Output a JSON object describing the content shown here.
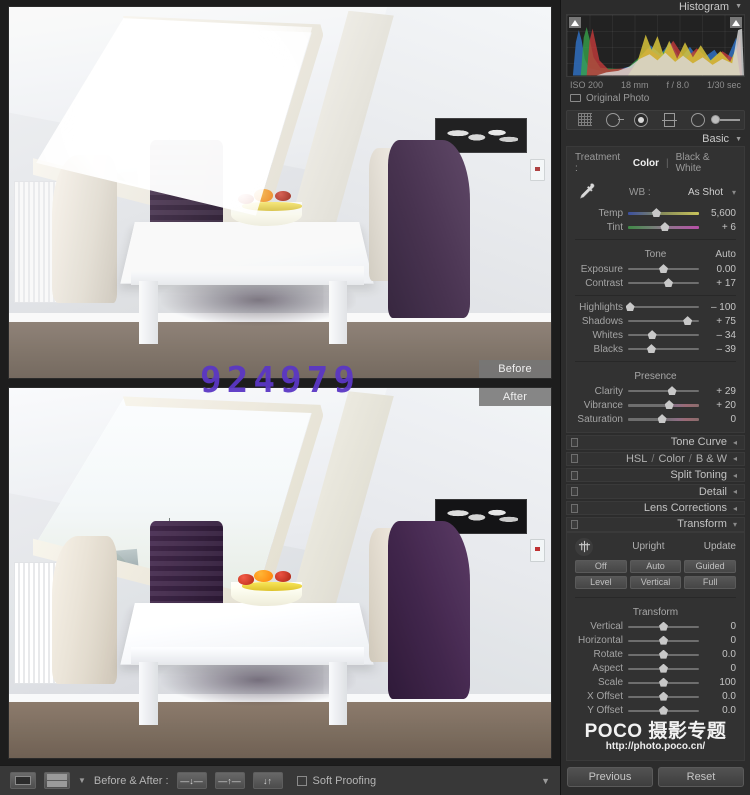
{
  "histogram": {
    "title": "Histogram",
    "exif": {
      "iso": "ISO 200",
      "focal": "18 mm",
      "aperture": "f / 8.0",
      "shutter": "1/30 sec"
    },
    "original_photo": "Original Photo"
  },
  "tools": [
    {
      "name": "crop-overlay-tool"
    },
    {
      "name": "spot-removal-tool"
    },
    {
      "name": "red-eye-correction-tool"
    },
    {
      "name": "graduated-filter-tool"
    },
    {
      "name": "radial-filter-tool"
    },
    {
      "name": "adjustment-brush-tool"
    }
  ],
  "basic": {
    "title": "Basic",
    "treatment_label": "Treatment :",
    "treatment_options": [
      "Color",
      "Black & White"
    ],
    "treatment_active": "Color",
    "wb_label": "WB :",
    "wb_value": "As Shot",
    "wb_sliders": [
      {
        "label": "Temp",
        "value": "5,600",
        "pos": 40,
        "track": "temp"
      },
      {
        "label": "Tint",
        "value": "+ 6",
        "pos": 52,
        "track": "tint"
      }
    ],
    "tone_title": "Tone",
    "auto_label": "Auto",
    "tone_sliders": [
      {
        "label": "Exposure",
        "value": "0.00",
        "pos": 50,
        "track": "plain"
      },
      {
        "label": "Contrast",
        "value": "+ 17",
        "pos": 57,
        "track": "plain"
      },
      {
        "label": "Highlights",
        "value": "– 100",
        "pos": 3,
        "track": "plain"
      },
      {
        "label": "Shadows",
        "value": "+ 75",
        "pos": 84,
        "track": "plain"
      },
      {
        "label": "Whites",
        "value": "– 34",
        "pos": 34,
        "track": "plain"
      },
      {
        "label": "Blacks",
        "value": "– 39",
        "pos": 33,
        "track": "plain"
      }
    ],
    "presence_title": "Presence",
    "presence_sliders": [
      {
        "label": "Clarity",
        "value": "+ 29",
        "pos": 62,
        "track": "plain"
      },
      {
        "label": "Vibrance",
        "value": "+ 20",
        "pos": 58,
        "track": "rainbow"
      },
      {
        "label": "Saturation",
        "value": "0",
        "pos": 48,
        "track": "rainbow"
      }
    ]
  },
  "collapsed_panels": [
    {
      "name": "Tone Curve",
      "type": "single"
    },
    {
      "name": "HSL / Color / B & W",
      "type": "hsl",
      "parts": [
        "HSL",
        "Color",
        "B & W"
      ]
    },
    {
      "name": "Split Toning",
      "type": "single"
    },
    {
      "name": "Detail",
      "type": "single"
    },
    {
      "name": "Lens Corrections",
      "type": "single"
    }
  ],
  "transform": {
    "title": "Transform",
    "upright_label": "Upright",
    "update_label": "Update",
    "upright_buttons_row1": [
      "Off",
      "Auto",
      "Guided"
    ],
    "upright_buttons_row2": [
      "Level",
      "Vertical",
      "Full"
    ],
    "section_label": "Transform",
    "sliders": [
      {
        "label": "Vertical",
        "value": "0",
        "pos": 50
      },
      {
        "label": "Horizontal",
        "value": "0",
        "pos": 50
      },
      {
        "label": "Rotate",
        "value": "0.0",
        "pos": 50
      },
      {
        "label": "Aspect",
        "value": "0",
        "pos": 50
      },
      {
        "label": "Scale",
        "value": "100",
        "pos": 50
      },
      {
        "label": "X Offset",
        "value": "0.0",
        "pos": 50
      },
      {
        "label": "Y Offset",
        "value": "0.0",
        "pos": 50
      }
    ]
  },
  "watermark": {
    "main": "POCO 摄影专题",
    "sub": "http://photo.poco.cn/",
    "overlay_digits": "924979"
  },
  "footer_buttons": {
    "previous": "Previous",
    "reset": "Reset"
  },
  "viewer": {
    "before_label": "Before",
    "after_label": "After"
  },
  "toolbar": {
    "before_after_label": "Before & After :",
    "copy_buttons": [
      "copy-after-to-before",
      "copy-before-to-after",
      "swap-before-after"
    ],
    "soft_proofing_label": "Soft Proofing"
  }
}
